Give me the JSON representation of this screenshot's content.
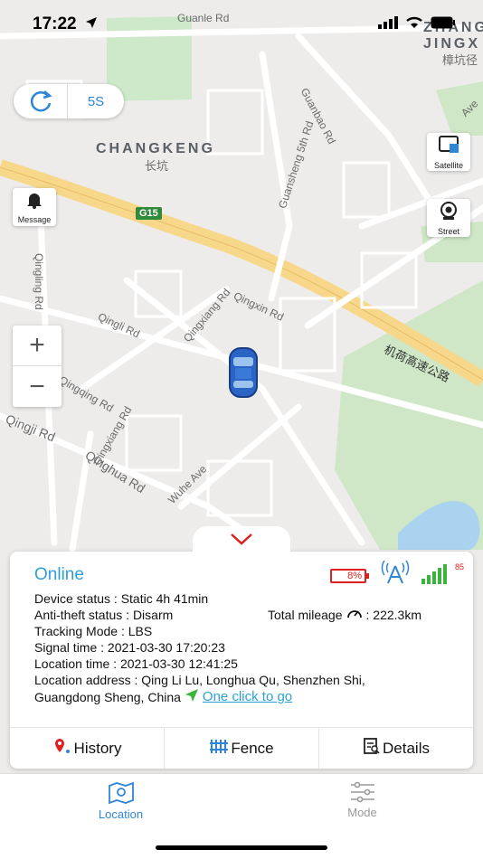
{
  "status_bar": {
    "time": "17:22"
  },
  "map": {
    "labels": {
      "guanle_rd": "Guanle Rd",
      "changkeng_en": "CHANGKENG",
      "changkeng_cn": "长坑",
      "guanbao_rd": "Guanbao Rd",
      "guansheng_rd": "Guansheng 5th Rd",
      "g15": "G15",
      "qingling_rd": "Qingling Rd",
      "qingxin_rd": "Qingxin Rd",
      "qingli_rd": "Qingli Rd",
      "qingxiang_rd": "Qingxiang Rd",
      "qingqing_rd": "Qingqing Rd",
      "qingji_rd": "Qingji Rd",
      "qinghua_rd": "Qinghua Rd",
      "wuhe_ave": "Wuhe Ave",
      "expressway_cn": "机荷高速公路",
      "jingxi": "JINGX",
      "zhang": "ZHANG",
      "jingxi_cn": "樟坑径",
      "ave": "Ave"
    },
    "refresh_interval": "5S",
    "satellite_label": "Satellite",
    "street_label": "Street",
    "message_label": "Message"
  },
  "device": {
    "status": "Online",
    "battery": "8%",
    "signal_strength": "85",
    "device_status": "Device status : Static 4h 41min",
    "antitheft_status": "Anti-theft status : Disarm",
    "tracking_mode": "Tracking Mode : LBS",
    "signal_time": "Signal time : 2021-03-30 17:20:23",
    "location_time": "Location time : 2021-03-30 12:41:25",
    "location_address_1": "Location address : Qing Li Lu, Longhua Qu, Shenzhen Shi,",
    "location_address_2": "Guangdong Sheng, China",
    "one_click": "One click to go",
    "mileage_label": "Total mileage",
    "mileage_value": ": 222.3km"
  },
  "actions": {
    "history": "History",
    "fence": "Fence",
    "details": "Details"
  },
  "tabs": [
    {
      "label": "Location",
      "active": true
    },
    {
      "label": "Mode",
      "active": false
    }
  ],
  "colors": {
    "accent": "#2f86d6",
    "online": "#2ea0d8",
    "battery_low": "#e02020",
    "signal": "#3cb33c"
  }
}
